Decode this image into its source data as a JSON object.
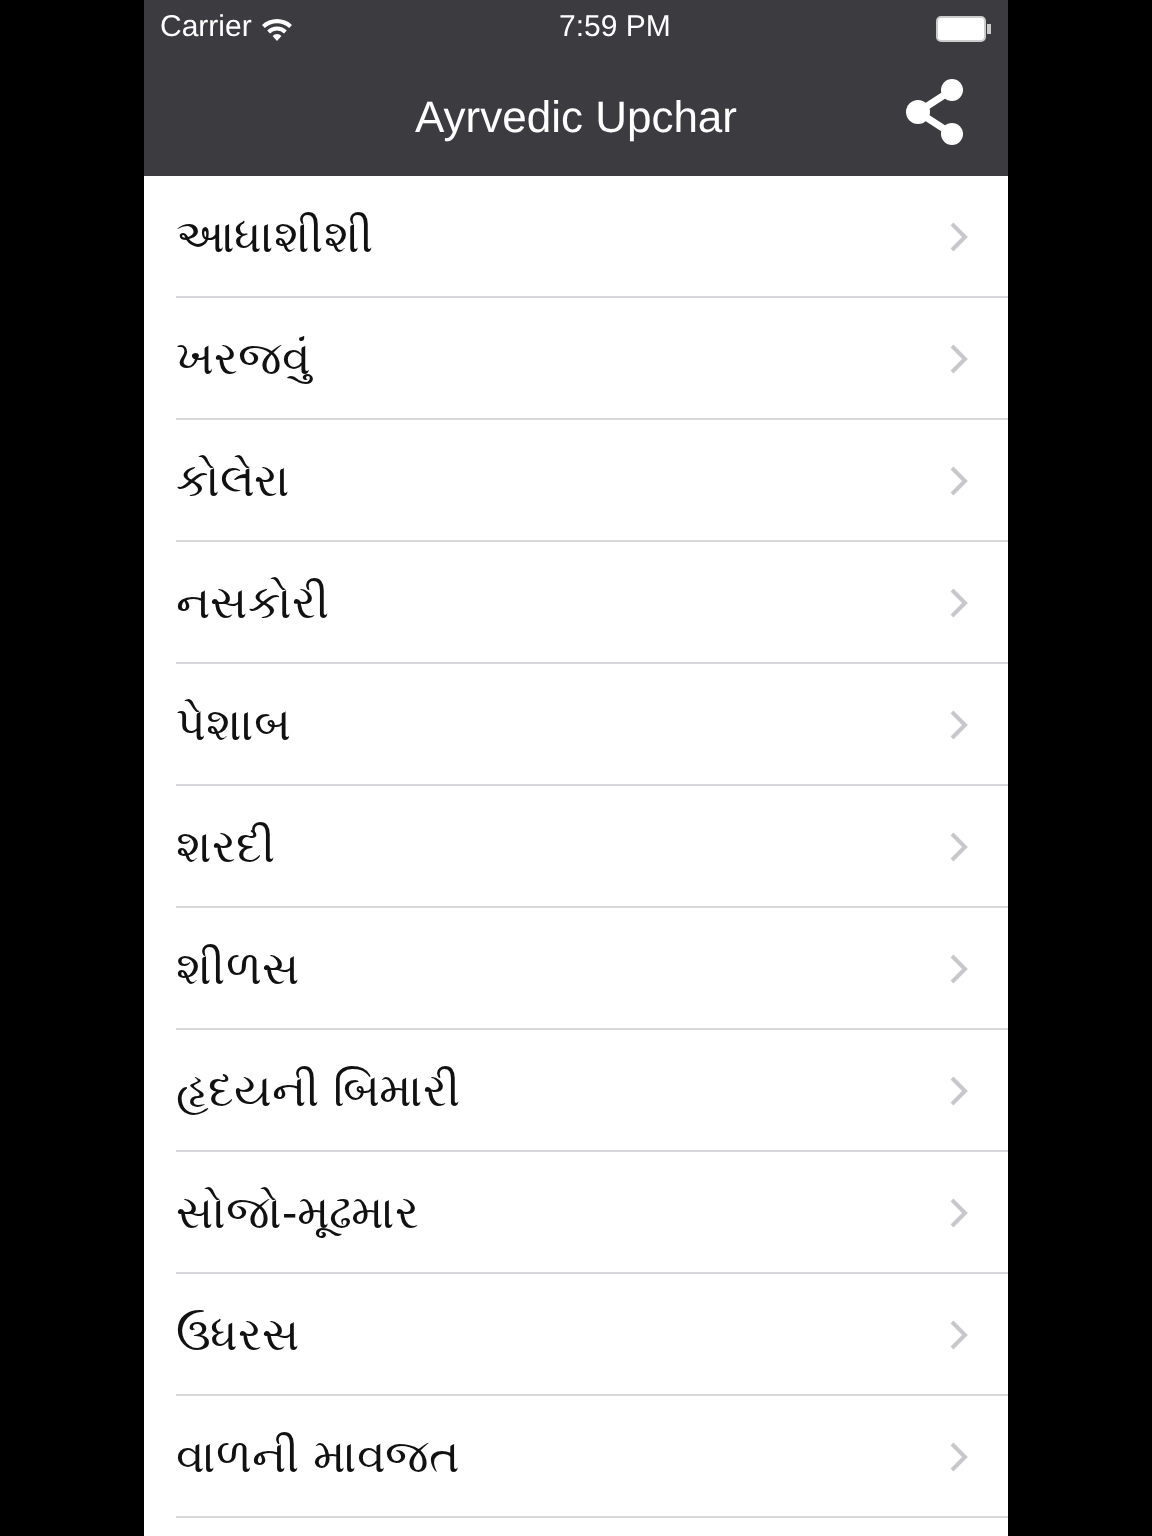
{
  "status_bar": {
    "carrier": "Carrier",
    "time": "7:59 PM"
  },
  "nav_bar": {
    "title": "Ayrvedic Upchar"
  },
  "items": [
    {
      "label": "આધાશીશી"
    },
    {
      "label": "ખરજવું"
    },
    {
      "label": "કોલેરા"
    },
    {
      "label": "નસકોરી"
    },
    {
      "label": "પેશાબ"
    },
    {
      "label": "શરદી"
    },
    {
      "label": "શીળસ"
    },
    {
      "label": "હૃદયની બિમારી"
    },
    {
      "label": "સોજો-મૂઢમાર"
    },
    {
      "label": "ઉધરસ"
    },
    {
      "label": "વાળની માવજત"
    }
  ]
}
